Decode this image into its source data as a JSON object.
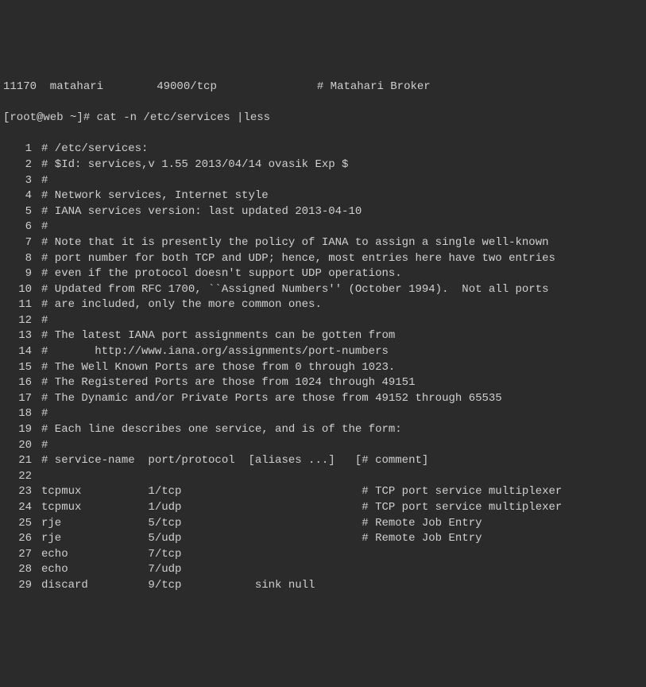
{
  "header_line": "11170  matahari        49000/tcp               # Matahari Broker",
  "prompt": "[root@web ~]# cat -n /etc/services |less",
  "lines": [
    {
      "n": "1",
      "text": "# /etc/services:"
    },
    {
      "n": "2",
      "text": "# $Id: services,v 1.55 2013/04/14 ovasik Exp $"
    },
    {
      "n": "3",
      "text": "#"
    },
    {
      "n": "4",
      "text": "# Network services, Internet style"
    },
    {
      "n": "5",
      "text": "# IANA services version: last updated 2013-04-10"
    },
    {
      "n": "6",
      "text": "#"
    },
    {
      "n": "7",
      "text": "# Note that it is presently the policy of IANA to assign a single well-known"
    },
    {
      "n": "8",
      "text": "# port number for both TCP and UDP; hence, most entries here have two entries"
    },
    {
      "n": "9",
      "text": "# even if the protocol doesn't support UDP operations."
    },
    {
      "n": "10",
      "text": "# Updated from RFC 1700, ``Assigned Numbers'' (October 1994).  Not all ports"
    },
    {
      "n": "11",
      "text": "# are included, only the more common ones."
    },
    {
      "n": "12",
      "text": "#"
    },
    {
      "n": "13",
      "text": "# The latest IANA port assignments can be gotten from"
    },
    {
      "n": "14",
      "text": "#       http://www.iana.org/assignments/port-numbers"
    },
    {
      "n": "15",
      "text": "# The Well Known Ports are those from 0 through 1023."
    },
    {
      "n": "16",
      "text": "# The Registered Ports are those from 1024 through 49151"
    },
    {
      "n": "17",
      "text": "# The Dynamic and/or Private Ports are those from 49152 through 65535"
    },
    {
      "n": "18",
      "text": "#"
    },
    {
      "n": "19",
      "text": "# Each line describes one service, and is of the form:"
    },
    {
      "n": "20",
      "text": "#"
    },
    {
      "n": "21",
      "text": "# service-name  port/protocol  [aliases ...]   [# comment]"
    },
    {
      "n": "22",
      "text": ""
    },
    {
      "n": "23",
      "text": "tcpmux          1/tcp                           # TCP port service multiplexer"
    },
    {
      "n": "24",
      "text": "tcpmux          1/udp                           # TCP port service multiplexer"
    },
    {
      "n": "25",
      "text": "rje             5/tcp                           # Remote Job Entry"
    },
    {
      "n": "26",
      "text": "rje             5/udp                           # Remote Job Entry"
    },
    {
      "n": "27",
      "text": "echo            7/tcp"
    },
    {
      "n": "28",
      "text": "echo            7/udp"
    },
    {
      "n": "29",
      "text": "discard         9/tcp           sink null"
    }
  ]
}
